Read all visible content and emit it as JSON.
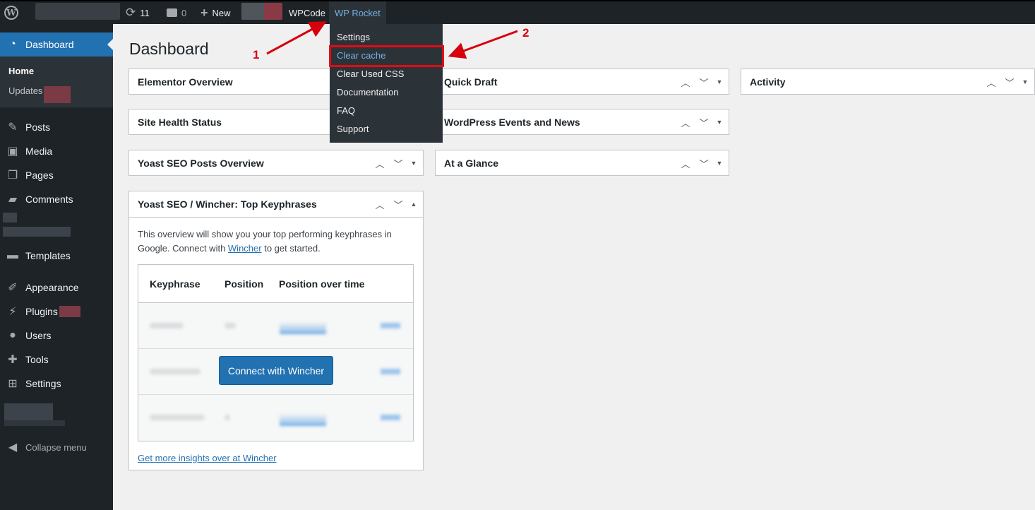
{
  "admin_bar": {
    "updates_count": "11",
    "comments_count": "0",
    "new_label": "New",
    "wpcode_label": "WPCode",
    "wprocket_label": "WP Rocket"
  },
  "wprocket_menu": [
    {
      "label": "Settings"
    },
    {
      "label": "Clear cache"
    },
    {
      "label": "Clear Used CSS"
    },
    {
      "label": "Documentation"
    },
    {
      "label": "FAQ"
    },
    {
      "label": "Support"
    }
  ],
  "sidebar": {
    "dashboard_label": "Dashboard",
    "submenu": [
      {
        "label": "Home"
      },
      {
        "label": "Updates"
      }
    ],
    "items": [
      {
        "label": "Posts",
        "icon": "pin-icon"
      },
      {
        "label": "Media",
        "icon": "media-icon"
      },
      {
        "label": "Pages",
        "icon": "pages-icon"
      },
      {
        "label": "Comments",
        "icon": "comment-icon"
      },
      {
        "label": "Templates",
        "icon": "folder-icon"
      },
      {
        "label": "Appearance",
        "icon": "brush-icon"
      },
      {
        "label": "Plugins",
        "icon": "plugin-icon"
      },
      {
        "label": "Users",
        "icon": "user-icon"
      },
      {
        "label": "Tools",
        "icon": "wrench-icon"
      },
      {
        "label": "Settings",
        "icon": "settings-icon"
      }
    ],
    "collapse_label": "Collapse menu"
  },
  "page": {
    "title": "Dashboard"
  },
  "widgets": {
    "elementor": "Elementor Overview",
    "site_health": "Site Health Status",
    "yoast_posts": "Yoast SEO Posts Overview",
    "keyphrases": "Yoast SEO / Wincher: Top Keyphrases",
    "quick_draft": "Quick Draft",
    "events": "WordPress Events and News",
    "glance": "At a Glance",
    "activity": "Activity"
  },
  "keyphrases": {
    "desc_before": "This overview will show you your top performing keyphrases in Google. Connect with ",
    "desc_link": "Wincher",
    "desc_after": " to get started.",
    "col_keyphrase": "Keyphrase",
    "col_position": "Position",
    "col_over_time": "Position over time",
    "connect_button": "Connect with Wincher",
    "more_link": "Get more insights over at Wincher"
  },
  "annotations": {
    "step1": "1",
    "step2": "2"
  },
  "colors": {
    "accent": "#2271b1",
    "highlight": "#e50914"
  }
}
